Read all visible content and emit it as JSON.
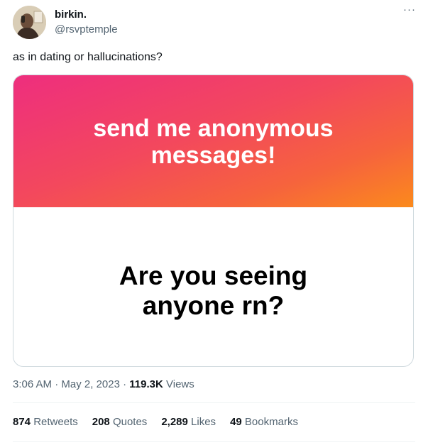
{
  "author": {
    "name": "birkin.",
    "handle": "@rsvptemple"
  },
  "more_glyph": "···",
  "tweet_text": "as in dating or hallucinations?",
  "card": {
    "top_line1": "send me anonymous",
    "top_line2": "messages!",
    "bottom_line1": "Are you seeing",
    "bottom_line2": "anyone rn?"
  },
  "meta": {
    "time": "3:06 AM",
    "sep1": "·",
    "date": "May 2, 2023",
    "sep2": "·",
    "views_count": "119.3K",
    "views_label": "Views"
  },
  "stats": [
    {
      "count": "874",
      "label": "Retweets"
    },
    {
      "count": "208",
      "label": "Quotes"
    },
    {
      "count": "2,289",
      "label": "Likes"
    },
    {
      "count": "49",
      "label": "Bookmarks"
    }
  ],
  "colors": {
    "gradient_start": "#ee2e7e",
    "gradient_end": "#fb8a1c",
    "secondary_text": "#536471"
  }
}
